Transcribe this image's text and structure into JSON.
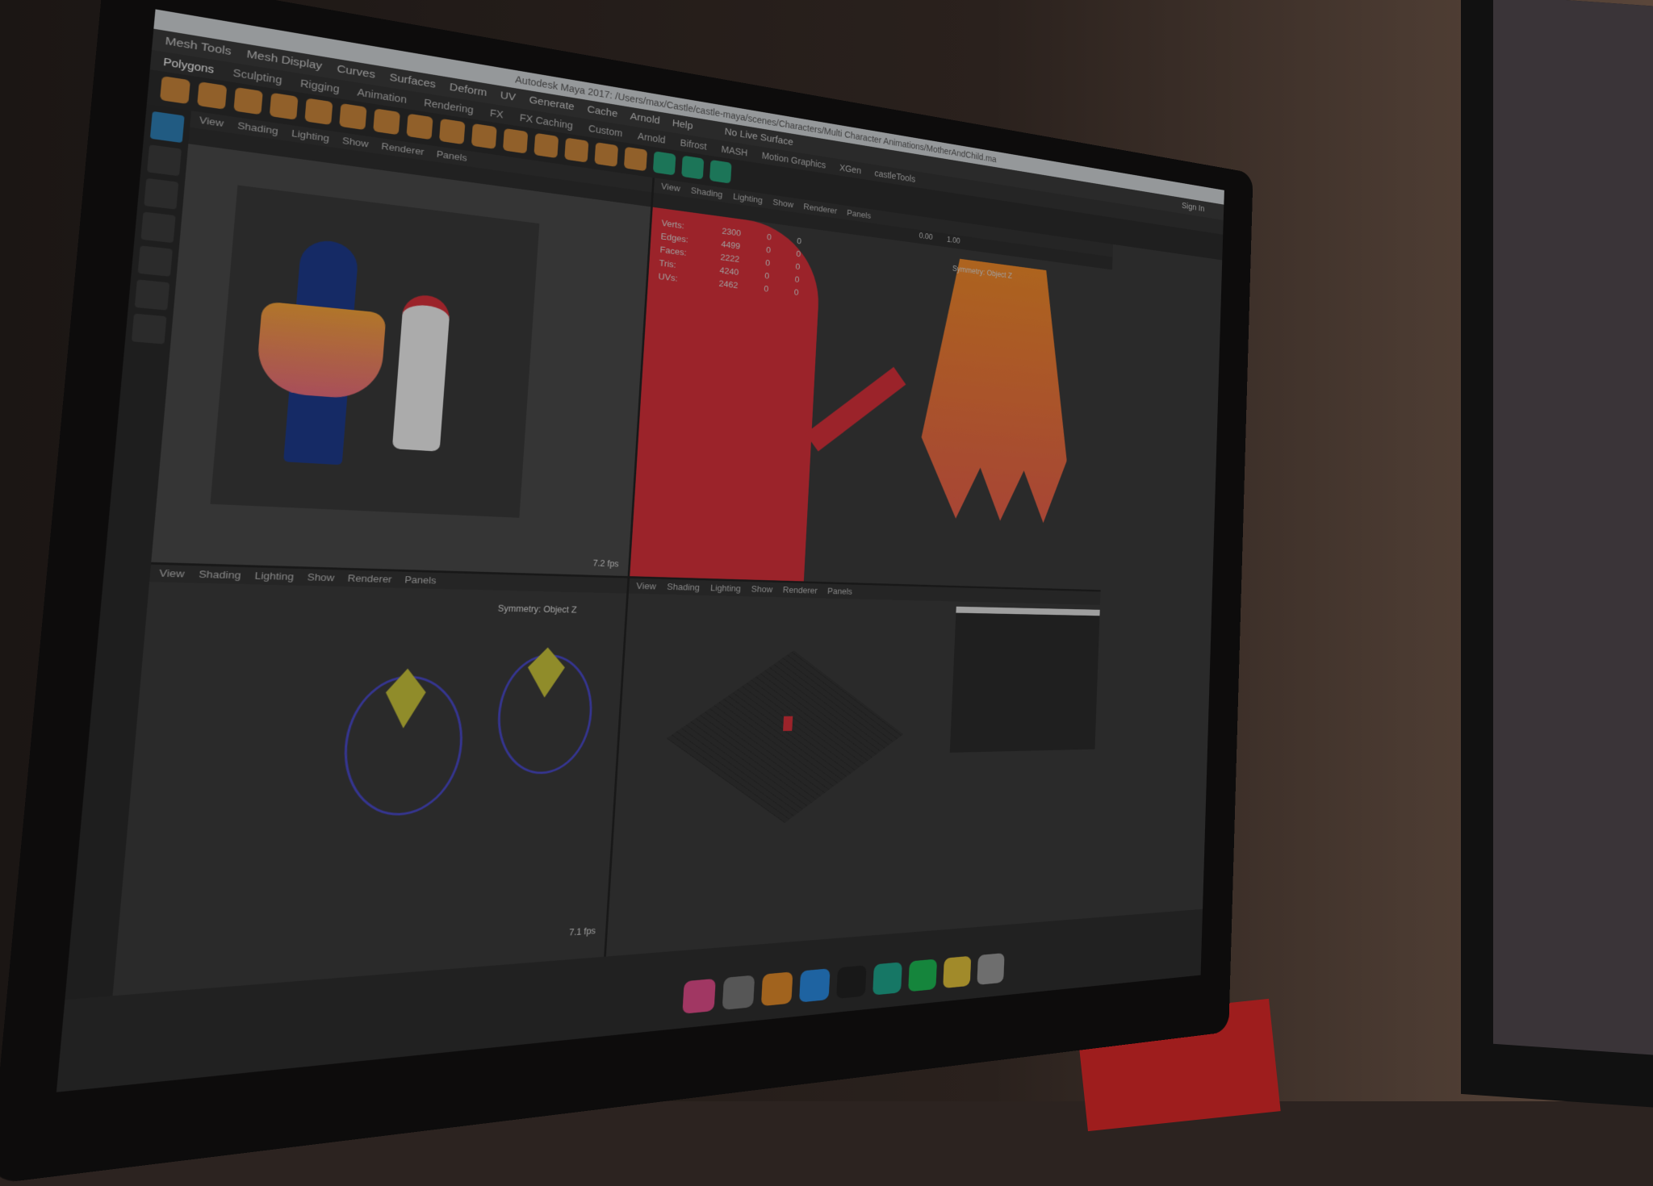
{
  "window": {
    "title": "Autodesk Maya 2017: /Users/max/Castle/castle-maya/scenes/Characters/Multi Character Animations/MotherAndChild.ma"
  },
  "menubar": [
    "Mesh Tools",
    "Mesh Display",
    "Curves",
    "Surfaces",
    "Deform",
    "UV",
    "Generate",
    "Cache",
    "Arnold",
    "Help"
  ],
  "live_surface": "No Live Surface",
  "sign_in": "Sign In",
  "shelf_tabs": [
    "Polygons",
    "Sculpting",
    "Rigging",
    "Animation",
    "Rendering",
    "FX",
    "FX Caching",
    "Custom",
    "Arnold",
    "Bifrost",
    "MASH",
    "Motion Graphics",
    "XGen",
    "castleTools"
  ],
  "viewport_menu": [
    "View",
    "Shading",
    "Lighting",
    "Show",
    "Renderer",
    "Panels"
  ],
  "hud": [
    {
      "label": "Verts:",
      "value": "2300",
      "a": "0",
      "b": "0"
    },
    {
      "label": "Edges:",
      "value": "4499",
      "a": "0",
      "b": "0"
    },
    {
      "label": "Faces:",
      "value": "2222",
      "a": "0",
      "b": "0"
    },
    {
      "label": "Tris:",
      "value": "4240",
      "a": "0",
      "b": "0"
    },
    {
      "label": "UVs:",
      "value": "2462",
      "a": "0",
      "b": "0"
    }
  ],
  "viewport_fields": {
    "near": "0.00",
    "far": "1.00"
  },
  "object_label": "Symmetry: Object Z",
  "fps": {
    "top_left": "7.2 fps",
    "bottom_left": "7.1 fps"
  },
  "colors": {
    "accent": "#2e7fb5",
    "character_red": "#d7313a",
    "character_orange": "#f08a2a",
    "rig_yellow": "#c8c23a"
  }
}
